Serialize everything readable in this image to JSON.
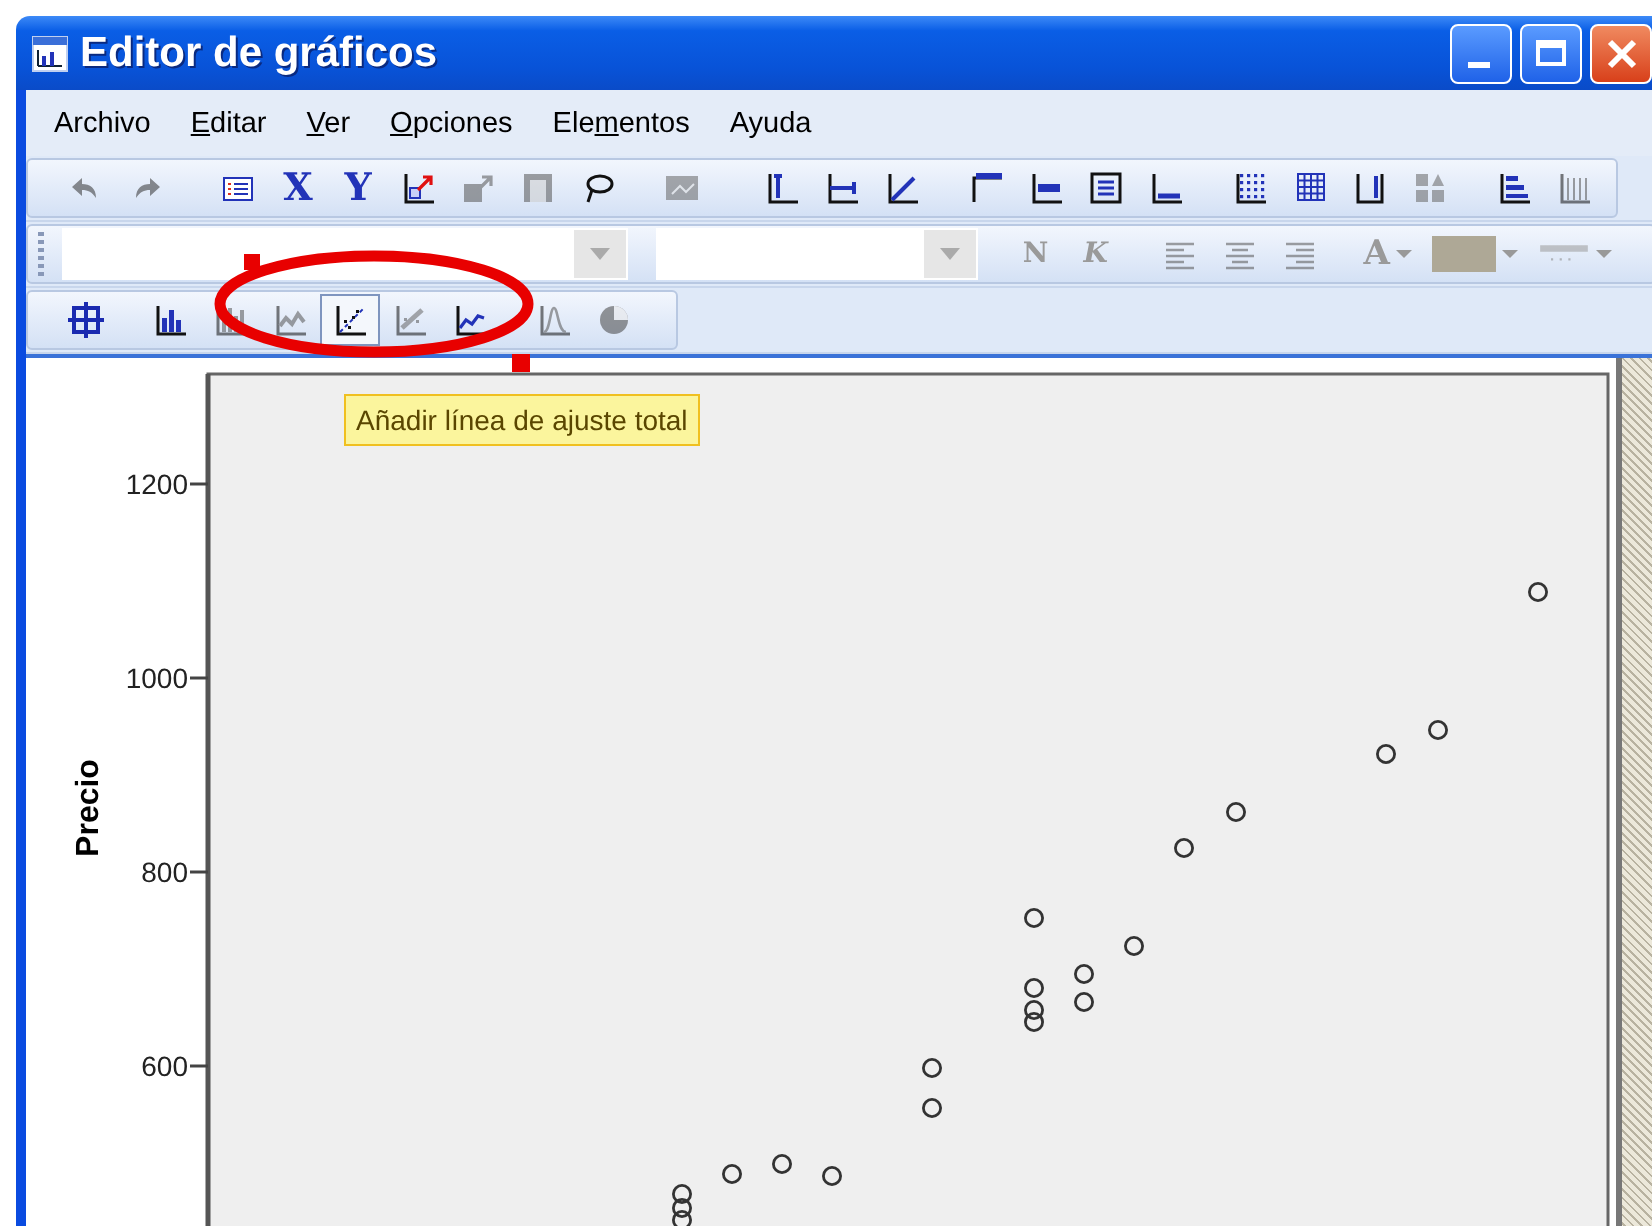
{
  "window": {
    "title": "Editor de gráficos"
  },
  "menu": [
    {
      "pre": "Archivo"
    },
    {
      "key": "E",
      "post": "ditar"
    },
    {
      "key": "V",
      "post": "er"
    },
    {
      "key": "O",
      "post": "pciones"
    },
    {
      "pre": "Ele",
      "key": "m",
      "post": "entos"
    },
    {
      "pre": "Ayuda"
    }
  ],
  "toolbar_1": {
    "groups": [
      {
        "buttons": [
          {
            "kind": "icon",
            "disabled": true
          },
          {
            "kind": "icon",
            "disabled": true
          }
        ]
      },
      {
        "buttons": [
          {
            "kind": "icon",
            "disabled": false
          },
          {
            "kind": "letter",
            "label": "X",
            "disabled": false
          },
          {
            "kind": "letter",
            "label": "Y",
            "disabled": false
          },
          {
            "kind": "icon",
            "disabled": false
          },
          {
            "kind": "icon",
            "disabled": true
          },
          {
            "kind": "icon",
            "disabled": true
          },
          {
            "kind": "icon",
            "disabled": false
          }
        ]
      },
      {
        "buttons": [
          {
            "kind": "icon",
            "disabled": true
          }
        ]
      },
      {
        "buttons": [
          {
            "kind": "icon",
            "disabled": false
          },
          {
            "kind": "icon",
            "disabled": false
          },
          {
            "kind": "icon",
            "disabled": false
          }
        ]
      },
      {
        "buttons": [
          {
            "kind": "icon",
            "disabled": false
          },
          {
            "kind": "icon",
            "disabled": false
          },
          {
            "kind": "icon",
            "disabled": false
          },
          {
            "kind": "icon",
            "disabled": false
          }
        ]
      },
      {
        "buttons": [
          {
            "kind": "icon",
            "disabled": false
          },
          {
            "kind": "icon",
            "disabled": false
          },
          {
            "kind": "icon",
            "disabled": false
          },
          {
            "kind": "icon",
            "disabled": true
          }
        ]
      },
      {
        "buttons": [
          {
            "kind": "icon",
            "disabled": false
          },
          {
            "kind": "icon",
            "disabled": true
          }
        ]
      }
    ]
  },
  "toolbar_2": {
    "combos": [
      {
        "disabled": true
      },
      {
        "disabled": true
      }
    ],
    "groups": [
      {
        "buttons": [
          {
            "kind": "letter",
            "label": "N",
            "disabled": true
          },
          {
            "kind": "letter",
            "label": "K",
            "disabled": true
          }
        ]
      },
      {
        "buttons": [
          {
            "kind": "icon",
            "disabled": true
          },
          {
            "kind": "icon",
            "disabled": true
          },
          {
            "kind": "icon",
            "disabled": true
          }
        ]
      },
      {
        "buttons": [
          {
            "kind": "letter_dropdown",
            "label": "A",
            "disabled": true
          },
          {
            "kind": "swatch_dropdown",
            "disabled": true
          },
          {
            "kind": "icon_dropdown",
            "disabled": true
          }
        ]
      }
    ]
  },
  "toolbar_3": {
    "groups": [
      {
        "buttons": [
          {
            "kind": "icon",
            "disabled": false,
            "hovered": false
          }
        ]
      },
      {
        "buttons": [
          {
            "kind": "icon",
            "disabled": false,
            "hovered": false
          },
          {
            "kind": "icon",
            "disabled": true,
            "hovered": false
          },
          {
            "kind": "icon",
            "disabled": true,
            "hovered": false
          },
          {
            "kind": "icon",
            "disabled": false,
            "hovered": true
          },
          {
            "kind": "icon",
            "disabled": true,
            "hovered": false
          },
          {
            "kind": "icon",
            "disabled": false,
            "hovered": false
          }
        ]
      },
      {
        "buttons": [
          {
            "kind": "icon",
            "disabled": true,
            "hovered": false
          },
          {
            "kind": "icon",
            "disabled": true,
            "hovered": false
          }
        ]
      }
    ]
  },
  "tooltip": {
    "text": "Añadir línea de ajuste total"
  },
  "chart": {
    "y_axis": {
      "title": "Precio",
      "ticks": [
        "1200",
        "1000",
        "800",
        "600"
      ]
    }
  }
}
